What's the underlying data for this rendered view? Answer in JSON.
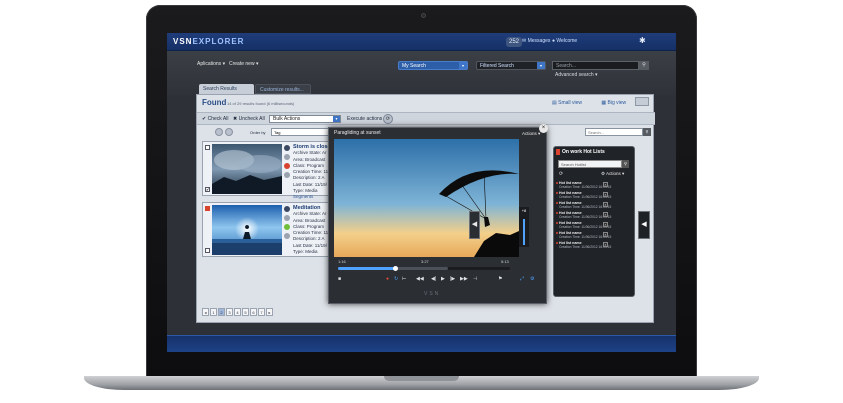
{
  "app": {
    "logo_prefix": "VSN",
    "logo_suffix": "EXPLORER",
    "notification_count": "252",
    "messages_label": "Messages",
    "welcome_label": "Welcome"
  },
  "menu": {
    "applications": "Aplications ▾",
    "create_new": "Create new ▾",
    "my_search": "My Search",
    "filtered_search": "Filtered Search",
    "search_placeholder": "Search...",
    "advanced_search": "Advanced search ▾"
  },
  "tabs": {
    "search_results": "Search Results",
    "customize": "Customize results..."
  },
  "results": {
    "found_title": "Found",
    "found_summary": "14 of 29 results found (6 milliseconds)",
    "small_view": "Small view",
    "big_view": "Big view",
    "check_all": "Check All",
    "uncheck_all": "Uncheck All",
    "bulk_actions": "Bulk Actions",
    "execute_actions": "Execute actions",
    "order_by": "Order by",
    "order_value": "Tag",
    "right_search_placeholder": "Search..."
  },
  "cards": [
    {
      "title": "Storm is close",
      "lines": [
        "Archive State: Ar",
        "Area: Broadcast",
        "Class: Program",
        "Creation Time: 11",
        "Description: 2 A",
        "Last Date: 11/19/",
        "Type: Media"
      ],
      "link": "Segments"
    },
    {
      "title": "Meditation",
      "lines": [
        "Archive State: Ar",
        "Area: Broadcast",
        "Class: Program",
        "Creation Time: 11",
        "Description: 2 A",
        "Last Date: 11/19/",
        "Type: Media"
      ],
      "link": ""
    }
  ],
  "pager": [
    "◂",
    "1",
    "2",
    "3",
    "4",
    "5",
    "6",
    "7",
    "▸"
  ],
  "player": {
    "title": "Paragliding  at sunset",
    "actions_label": "Actions ▾",
    "time_start": "1:16",
    "time_mid": "3:27",
    "time_end": "5:13",
    "volume_label": "+8",
    "progress_fraction": 0.33,
    "watermark": "VSN"
  },
  "hotlists": {
    "title": "On work Hot Lists",
    "search_placeholder": "Search Hotlist",
    "actions_label": "Actions ▾",
    "items": [
      {
        "name": "Hot list name",
        "created": "Creation Time: 11/06/2012 16:04:15"
      },
      {
        "name": "Hot list name",
        "created": "Creation Time: 11/06/2012 16:04:15"
      },
      {
        "name": "Hot list name",
        "created": "Creation Time: 11/06/2012 16:04:15"
      },
      {
        "name": "Hot list name",
        "created": "Creation Time: 11/06/2012 16:04:15"
      },
      {
        "name": "Hot list name",
        "created": "Creation Time: 11/06/2012 16:04:15"
      },
      {
        "name": "Hot list name",
        "created": "Creation Time: 11/06/2012 16:04:15"
      },
      {
        "name": "Hot list name",
        "created": "Creation Time: 11/06/2012 16:04:15"
      }
    ]
  },
  "colors": {
    "brand_blue": "#1f3d7a",
    "accent_blue": "#4fa3ff",
    "flag_red": "#d8432f"
  }
}
